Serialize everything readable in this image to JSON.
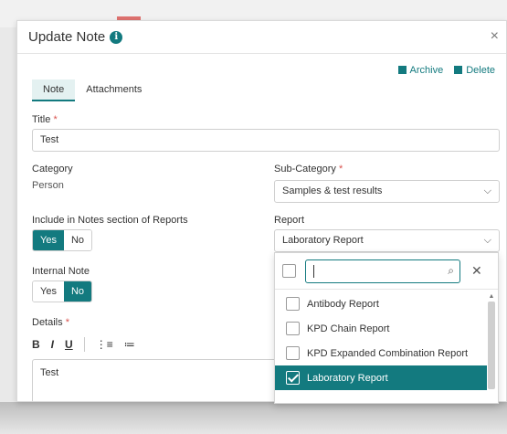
{
  "modal": {
    "title": "Update Note",
    "close": "×",
    "actions": {
      "archive": "Archive",
      "delete": "Delete"
    },
    "tabs": [
      "Note",
      "Attachments"
    ],
    "active_tab": "Note"
  },
  "form": {
    "title_label": "Title",
    "title_value": "Test",
    "category_label": "Category",
    "category_value": "Person",
    "subcategory_label": "Sub-Category",
    "subcategory_value": "Samples & test results",
    "include_label": "Include in Notes section of Reports",
    "include_options": {
      "yes": "Yes",
      "no": "No"
    },
    "include_selected": "Yes",
    "report_label": "Report",
    "report_value": "Laboratory Report",
    "internal_label": "Internal Note",
    "internal_options": {
      "yes": "Yes",
      "no": "No"
    },
    "internal_selected": "No",
    "details_label": "Details",
    "details_value": "Test",
    "required_mark": "*"
  },
  "editor_toolbar": {
    "bold": "B",
    "italic": "I",
    "underline": "U",
    "ordered_list": "⋮≡",
    "bullet_list": "≔"
  },
  "dropdown": {
    "search_value": "",
    "items": [
      {
        "label": "Antibody Report",
        "selected": false
      },
      {
        "label": "KPD Chain Report",
        "selected": false
      },
      {
        "label": "KPD Expanded Combination Report",
        "selected": false
      },
      {
        "label": "Laboratory Report",
        "selected": true
      }
    ]
  },
  "colors": {
    "accent": "#137a7f",
    "required": "#d9534f"
  }
}
